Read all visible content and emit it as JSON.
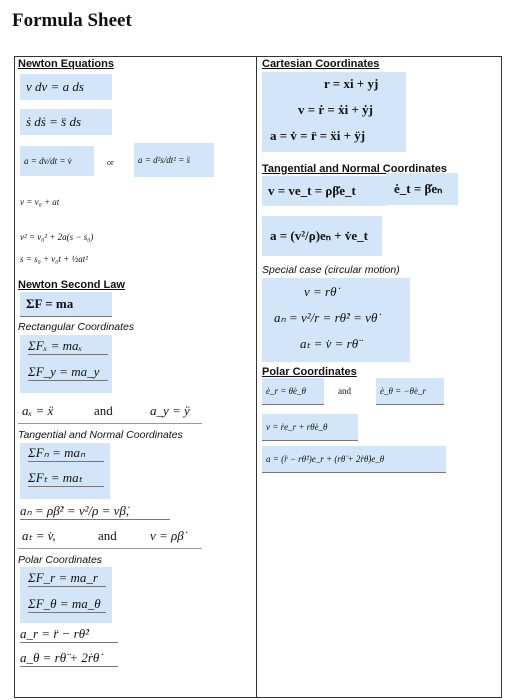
{
  "title": "Formula Sheet",
  "left": {
    "newton_equations": {
      "heading": "Newton Equations",
      "eq1": "v dv = a ds",
      "eq2": "ṡ dṡ = s̈ ds",
      "eq3a": "a = dv/dt = v̇",
      "or": "or",
      "eq3b": "a = d²s/dt² = s̈",
      "eq4": "v = v₀ + at",
      "eq5": "v² = v₀² + 2a(s − s₀)",
      "eq6": "s = s₀ + v₀t + ½at²"
    },
    "newton_second_law": {
      "heading": "Newton Second Law",
      "eq": "ΣF = ma",
      "rect_label": "Rectangular Coordinates",
      "rect_eq1": "ΣFₓ = maₓ",
      "rect_eq2": "ΣF_y = ma_y",
      "rect_eq3a": "aₓ = ẍ",
      "and": "and",
      "rect_eq3b": "a_y = ÿ",
      "tn_label": "Tangential and Normal Coordinates",
      "tn_eq1": "ΣFₙ = maₙ",
      "tn_eq2": "ΣFₜ = maₜ",
      "tn_eq3": "aₙ = ρβ̇² = v²/ρ = vβ̇,",
      "tn_eq4a": "aₜ = v̇,",
      "tn_eq4b": "v = ρβ̇",
      "polar_label": "Polar Coordinates",
      "polar_eq1": "ΣF_r = ma_r",
      "polar_eq2": "ΣF_θ = ma_θ",
      "polar_eq3": "a_r = r̈ − rθ̇²",
      "polar_eq4": "a_θ = rθ̈ + 2ṙθ̇"
    }
  },
  "right": {
    "cartesian": {
      "heading": "Cartesian Coordinates",
      "eq1": "r = xi + yj",
      "eq2": "v = ṙ = ẋi + ẏj",
      "eq3": "a = v̇ = r̈ = ẍi + ÿj"
    },
    "tangential_normal": {
      "heading": "Tangential and Normal Coordinates",
      "eq1": "v = ve_t = ρβ̇e_t",
      "eq2": "ė_t = β̇eₙ",
      "eq3": "a = (v²/ρ)eₙ + v̇e_t",
      "special_label": "Special case (circular motion)",
      "sc_eq1": "v = rθ̇",
      "sc_eq2": "aₙ = v²/r = rθ̇² = vθ̇",
      "sc_eq3": "aₜ = v̇ = rθ̈"
    },
    "polar": {
      "heading": "Polar Coordinates",
      "eq1a": "ė_r = θ̇e_θ",
      "and": "and",
      "eq1b": "ė_θ = −θ̇e_r",
      "eq2": "v = ṙe_r + rθ̇e_θ",
      "eq3": "a = (r̈ − rθ̇²)e_r + (rθ̈ + 2ṙθ̇)e_θ"
    }
  },
  "colors": {
    "highlight": "#d3e5f8",
    "border": "#333333"
  }
}
